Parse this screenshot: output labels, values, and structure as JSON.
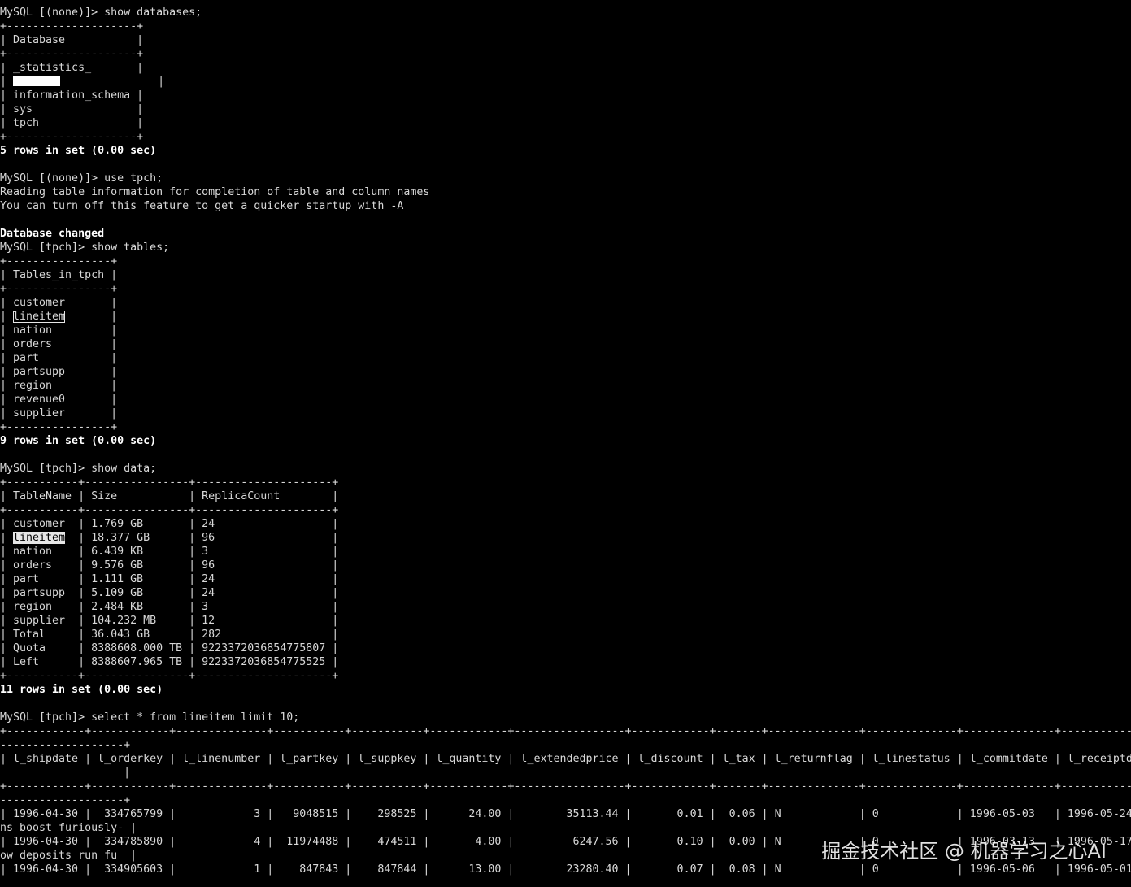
{
  "terminal": {
    "lines": [
      "MySQL [(none)]> show databases;",
      "+--------------------+",
      "| Database           |",
      "+--------------------+",
      "| _statistics_       |",
      {
        "segments": [
          {
            "text": "| "
          },
          {
            "redact": 58
          },
          {
            "text": "               |"
          }
        ]
      },
      "| information_schema |",
      "| sys                |",
      "| tpch               |",
      "+--------------------+",
      {
        "text": "5 rows in set (0.00 sec)",
        "bold": true
      },
      "",
      "MySQL [(none)]> use tpch;",
      "Reading table information for completion of table and column names",
      "You can turn off this feature to get a quicker startup with -A",
      "",
      {
        "text": "Database changed",
        "bold": true
      },
      "MySQL [tpch]> show tables;",
      "+----------------+",
      "| Tables_in_tpch |",
      "+----------------+",
      "| customer       |",
      {
        "segments": [
          {
            "text": "| "
          },
          {
            "text": "lineitem",
            "outline": true
          },
          {
            "text": "       |"
          }
        ]
      },
      "| nation         |",
      "| orders         |",
      "| part           |",
      "| partsupp       |",
      "| region         |",
      "| revenue0       |",
      "| supplier       |",
      "+----------------+",
      {
        "text": "9 rows in set (0.00 sec)",
        "bold": true
      },
      "",
      "MySQL [tpch]> show data;",
      "+-----------+----------------+---------------------+",
      "| TableName | Size           | ReplicaCount        |",
      "+-----------+----------------+---------------------+",
      "| customer  | 1.769 GB       | 24                  |",
      {
        "segments": [
          {
            "text": "| "
          },
          {
            "text": "lineitem",
            "highlight": true
          },
          {
            "text": "  | 18.377 GB      | 96                  |"
          }
        ]
      },
      "| nation    | 6.439 KB       | 3                   |",
      "| orders    | 9.576 GB       | 96                  |",
      "| part      | 1.111 GB       | 24                  |",
      "| partsupp  | 5.109 GB       | 24                  |",
      "| region    | 2.484 KB       | 3                   |",
      "| supplier  | 104.232 MB     | 12                  |",
      "| Total     | 36.043 GB      | 282                 |",
      "| Quota     | 8388608.000 TB | 9223372036854775807 |",
      "| Left      | 8388607.965 TB | 9223372036854775525 |",
      "+-----------+----------------+---------------------+",
      {
        "text": "11 rows in set (0.00 sec)",
        "bold": true
      },
      "",
      "MySQL [tpch]> select * from lineitem limit 10;",
      "+------------+------------+--------------+-----------+-----------+------------+-----------------+------------+-------+--------------+--------------+--------------+--------------",
      "-------------------+",
      "| l_shipdate | l_orderkey | l_linenumber | l_partkey | l_suppkey | l_quantity | l_extendedprice | l_discount | l_tax | l_returnflag | l_linestatus | l_commitdate | l_receiptdate",
      "                   |",
      "+------------+------------+--------------+-----------+-----------+------------+-----------------+------------+-------+--------------+--------------+--------------+--------------",
      "-------------------+",
      "| 1996-04-30 |  334765799 |            3 |   9048515 |    298525 |      24.00 |        35113.44 |       0.01 |  0.06 | N            | 0            | 1996-05-03   | 1996-05-24",
      "ns boost furiously- |",
      "| 1996-04-30 |  334785890 |            4 |  11974488 |    474511 |       4.00 |         6247.56 |       0.10 |  0.00 | N            | 0            | 1996-03-13   | 1996-05-17",
      "ow deposits run fu  |",
      "| 1996-04-30 |  334905603 |            1 |    847843 |    847844 |      13.00 |        23280.40 |       0.07 |  0.08 | N            | 0            | 1996-05-06   | 1996-05-01"
    ]
  },
  "watermark": {
    "text": "掘金技术社区 @ 机器学习之心AI"
  },
  "colors": {
    "background": "#000000",
    "foreground": "#d8d8d8",
    "bold_foreground": "#ffffff",
    "highlight_background": "#e6e6e6"
  }
}
